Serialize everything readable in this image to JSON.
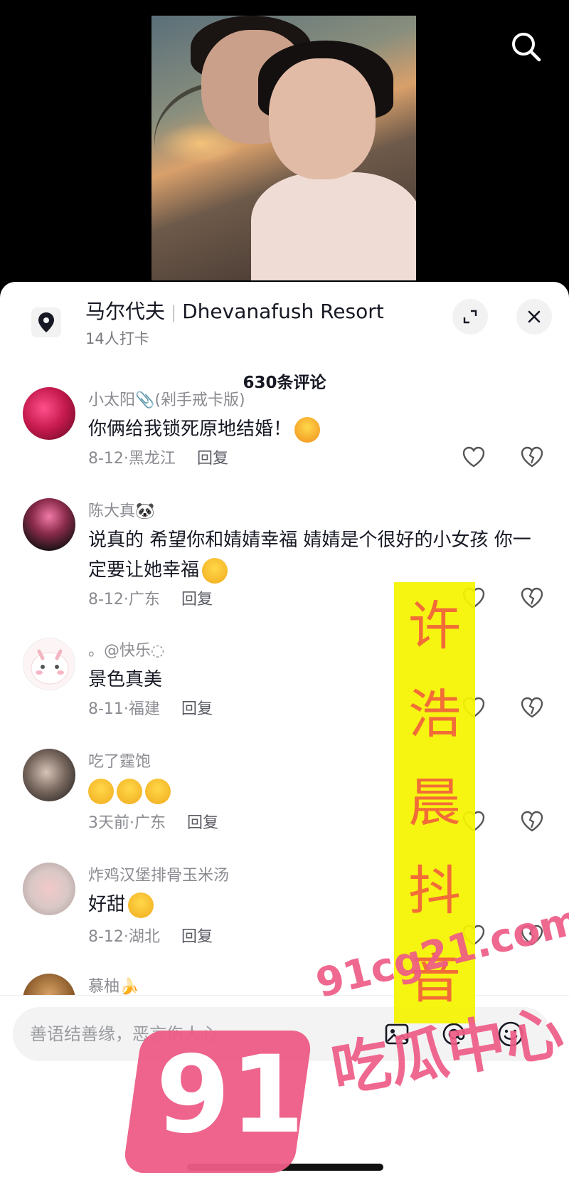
{
  "video": {
    "search_icon": "search-icon"
  },
  "location": {
    "icon": "location-pin-icon",
    "name_cn": "马尔代夫",
    "name_en": "Dhevanafush Resort",
    "checkins": "14人打卡",
    "expand_icon": "expand-icon",
    "close_icon": "close-icon"
  },
  "comments_header": "630条评论",
  "comments": [
    {
      "name": "小太阳📎(剁手戒卡版)",
      "text": "你俩给我锁死原地结婚！",
      "emoji": "hug-face-emoji",
      "date": "8-12·黑龙江",
      "reply": "回复",
      "avatar_color": "#c2184b"
    },
    {
      "name": "陈大真🐼",
      "text": "说真的 希望你和婧婧幸福 婧婧是个很好的小女孩 你一定要让她幸福",
      "emoji": "crying-face-emoji",
      "date": "8-12·广东",
      "reply": "回复",
      "avatar_color": "#2b1d22"
    },
    {
      "name": "。@快乐◌",
      "text": "景色真美",
      "emoji": "",
      "date": "8-11·福建",
      "reply": "回复",
      "avatar_color": "#fdf5f5"
    },
    {
      "name": "吃了霆饱",
      "text": "",
      "emoji": "laughing-tears-emoji x3",
      "date": "3天前·广东",
      "reply": "回复",
      "avatar_color": "#3a3532"
    },
    {
      "name": "炸鸡汉堡排骨玉米汤",
      "text": "好甜",
      "emoji": "pleading-face-emoji",
      "date": "8-12·湖北",
      "reply": "回复",
      "avatar_color": "#d9c8c6"
    },
    {
      "name": "慕柚🍌",
      "avatar_color": "#8a5a2a"
    }
  ],
  "input": {
    "placeholder": "善语结善缘，恶言伤人心",
    "image_icon": "image-icon",
    "at_icon": "at-icon",
    "emoji_icon": "emoji-icon"
  },
  "watermarks": {
    "vertical_text": [
      "许",
      "浩",
      "晨",
      "抖",
      "音"
    ],
    "logo_number": "91",
    "url": "91cg21.com",
    "site_name": "吃瓜中心",
    "yellow_color": "#f6f400",
    "orange_text_color": "#f2612a",
    "pink_color": "#ee5c86"
  }
}
